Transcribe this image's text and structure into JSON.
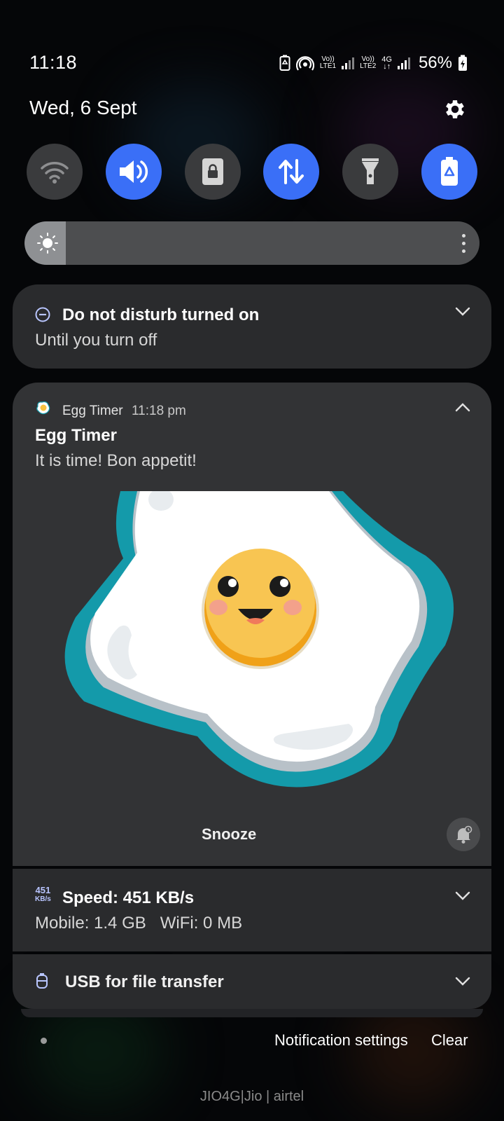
{
  "status_bar": {
    "time": "11:18",
    "sim1_volte": "Vo))",
    "sim1_label": "LTE1",
    "sim2_volte": "Vo))",
    "sim2_label": "LTE2",
    "sim2_net": "4G",
    "battery": "56%",
    "icons": [
      "battery-saver-icon",
      "hotspot-icon",
      "signal-icon",
      "signal-icon",
      "charging-battery-icon"
    ]
  },
  "header": {
    "date": "Wed, 6 Sept",
    "settings_icon": "gear-icon"
  },
  "quick_tiles": [
    {
      "icon": "wifi-icon",
      "active": false
    },
    {
      "icon": "sound-icon",
      "active": true
    },
    {
      "icon": "screen-lock-icon",
      "active": false
    },
    {
      "icon": "mobile-data-icon",
      "active": true
    },
    {
      "icon": "flashlight-icon",
      "active": false
    },
    {
      "icon": "power-saving-icon",
      "active": true
    }
  ],
  "brightness": {
    "level": 0.09
  },
  "notifications": {
    "dnd": {
      "title": "Do not disturb turned on",
      "subtitle": "Until you turn off"
    },
    "egg_timer": {
      "app_name": "Egg Timer",
      "time": "11:18 pm",
      "title": "Egg Timer",
      "text": "It is time! Bon appetit!",
      "action": "Snooze"
    },
    "speed": {
      "icon_top": "451",
      "icon_bottom": "KB/s",
      "title": "Speed: 451 KB/s",
      "subtitle": "Mobile: 1.4 GB   WiFi: 0 MB"
    },
    "usb": {
      "title": "USB for file transfer"
    }
  },
  "footer": {
    "settings": "Notification settings",
    "clear": "Clear"
  },
  "carrier": "JIO4G|Jio | airtel",
  "colors": {
    "accent": "#3a6ff7",
    "card": "#2a2b2d",
    "egg_teal": "#149aaa",
    "yolk": "#f7c23f"
  }
}
